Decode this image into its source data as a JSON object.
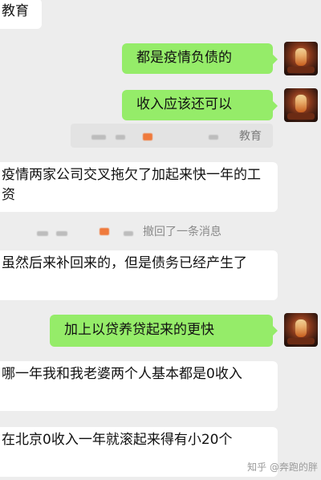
{
  "messages": {
    "m0": "教育",
    "m1": "都是疫情负债的",
    "m2": "收入应该还可以",
    "quote_label": "教育",
    "m3": "疫情两家公司交叉拖欠了加起来快一年的工资",
    "system_text": "撤回了一条消息",
    "m4": "虽然后来补回来的，但是债务已经产生了",
    "m5": "加上以贷养贷起来的更快",
    "m6": "哪一年我和我老婆两个人基本都是0收入",
    "m7": "在北京0收入一年就滚起来得有小20个"
  },
  "watermark": "知乎 @奔跑的胖",
  "colors": {
    "sent_bubble": "#95ec69",
    "recv_bubble": "#ffffff",
    "background": "#ededed"
  },
  "icons": {
    "avatar": "user-avatar-image"
  }
}
